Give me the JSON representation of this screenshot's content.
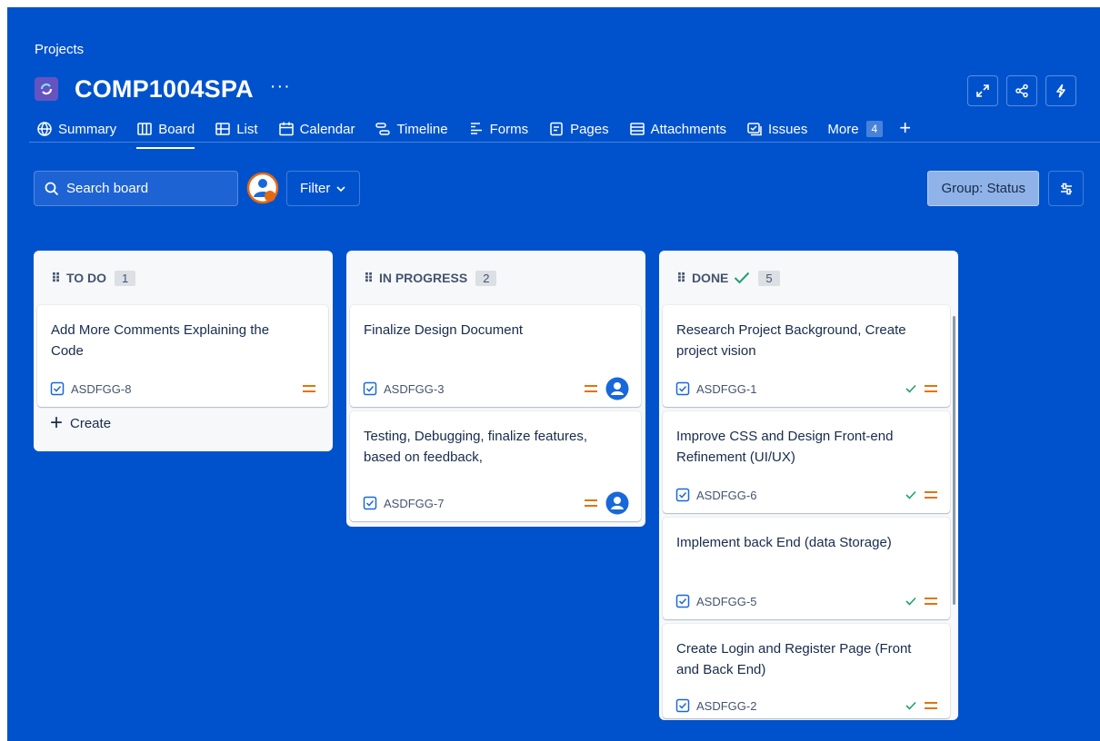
{
  "breadcrumb": "Projects",
  "project": {
    "title": "COMP1004SPA",
    "more": "···"
  },
  "tabs": [
    {
      "label": "Summary",
      "icon": "globe-icon"
    },
    {
      "label": "Board",
      "icon": "board-icon"
    },
    {
      "label": "List",
      "icon": "list-icon"
    },
    {
      "label": "Calendar",
      "icon": "calendar-icon"
    },
    {
      "label": "Timeline",
      "icon": "timeline-icon"
    },
    {
      "label": "Forms",
      "icon": "forms-icon"
    },
    {
      "label": "Pages",
      "icon": "pages-icon"
    },
    {
      "label": "Attachments",
      "icon": "attachments-icon"
    },
    {
      "label": "Issues",
      "icon": "issues-icon"
    },
    {
      "label": "More",
      "count": "4"
    }
  ],
  "tab_plus": "+",
  "toolbar": {
    "search_placeholder": "Search board",
    "filter_label": "Filter",
    "group_label": "Group: Status"
  },
  "columns": [
    {
      "title": "TO DO",
      "count": "1",
      "cards": [
        {
          "title": "Add More Comments Explaining the Code",
          "key": "ASDFGG-8"
        }
      ],
      "create_label": "Create"
    },
    {
      "title": "IN PROGRESS",
      "count": "2",
      "cards": [
        {
          "title": "Finalize Design Document",
          "key": "ASDFGG-3"
        },
        {
          "title": "Testing, Debugging, finalize features, based on feedback,",
          "key": "ASDFGG-7"
        }
      ]
    },
    {
      "title": "DONE",
      "count": "5",
      "cards": [
        {
          "title": "Research Project Background, Create project vision",
          "key": "ASDFGG-1"
        },
        {
          "title": "Improve CSS and Design Front-end Refinement (UI/UX)",
          "key": "ASDFGG-6"
        },
        {
          "title": "Implement back End (data Storage)",
          "key": "ASDFGG-5"
        },
        {
          "title": "Create Login and Register Page (Front and Back End)",
          "key": "ASDFGG-2"
        }
      ]
    }
  ],
  "colors": {
    "background": "#0052cc",
    "priority_medium": "#e2740a",
    "done_check": "#22a06b",
    "task_icon": "#1868db",
    "project_icon": "#6554c0"
  }
}
